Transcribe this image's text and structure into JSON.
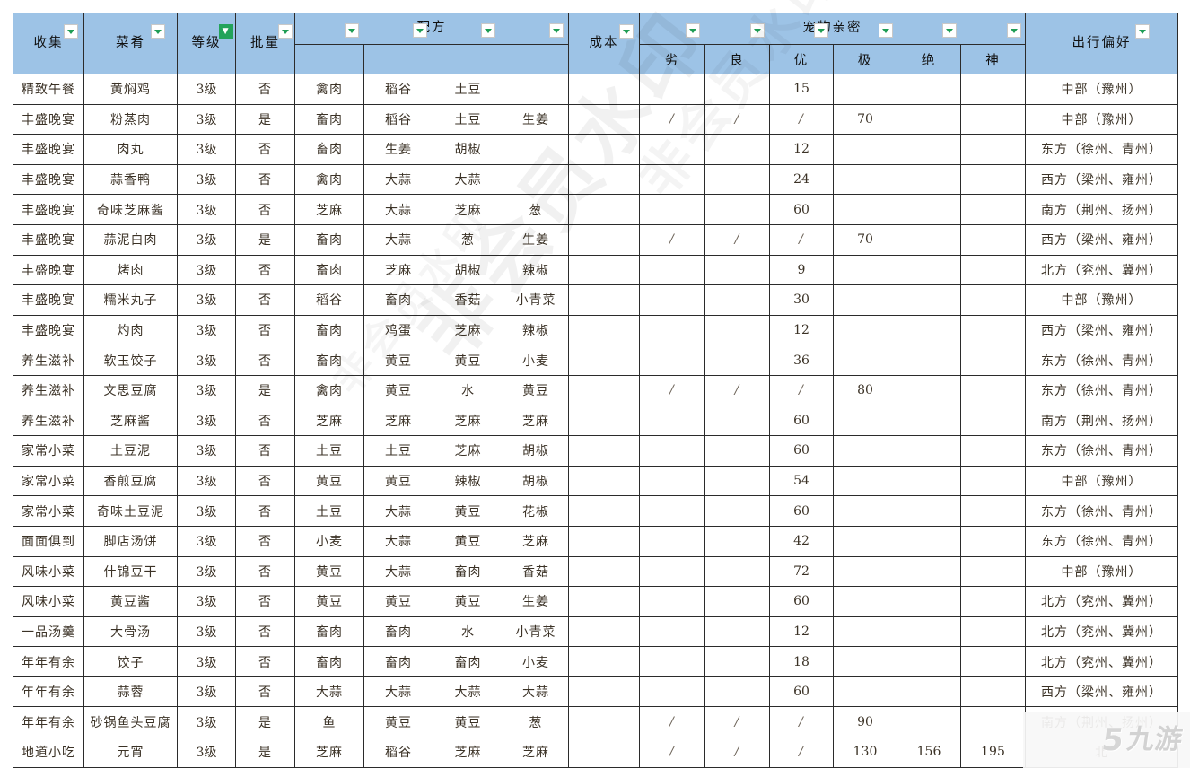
{
  "sheet": {
    "header": {
      "groups": [
        {
          "label": "收集",
          "key": "collect",
          "span": 1,
          "filter": "dropdown"
        },
        {
          "label": "菜肴",
          "key": "dish",
          "span": 1,
          "filter": "dropdown"
        },
        {
          "label": "等级",
          "key": "level",
          "span": 1,
          "filter": "active-filter"
        },
        {
          "label": "批量",
          "key": "batch",
          "span": 1,
          "filter": "dropdown"
        },
        {
          "label": "配方",
          "key": "recipe",
          "span": 4,
          "filter": "dropdown"
        },
        {
          "label": "成本",
          "key": "cost",
          "span": 1,
          "filter": "dropdown"
        },
        {
          "label": "宠物亲密",
          "key": "pet_intimacy",
          "span": 6,
          "filter": "dropdown"
        },
        {
          "label": "出行偏好",
          "key": "travel_pref",
          "span": 1,
          "filter": "dropdown"
        }
      ],
      "pet_sub_headers": [
        "劣",
        "良",
        "优",
        "极",
        "绝",
        "神"
      ]
    },
    "rows": [
      {
        "collect": "精致午餐",
        "dish": "黄焖鸡",
        "level": "3级",
        "batch": "否",
        "recipe": [
          "禽肉",
          "稻谷",
          "土豆",
          ""
        ],
        "cost": "",
        "pet": [
          "",
          "",
          "15",
          "",
          "",
          ""
        ],
        "travel": "中部（豫州）"
      },
      {
        "collect": "丰盛晚宴",
        "dish": "粉蒸肉",
        "level": "3级",
        "batch": "是",
        "recipe": [
          "畜肉",
          "稻谷",
          "土豆",
          "生姜"
        ],
        "cost": "",
        "pet": [
          "/",
          "/",
          "/",
          "70",
          "",
          ""
        ],
        "travel": "中部（豫州）"
      },
      {
        "collect": "丰盛晚宴",
        "dish": "肉丸",
        "level": "3级",
        "batch": "否",
        "recipe": [
          "畜肉",
          "生姜",
          "胡椒",
          ""
        ],
        "cost": "",
        "pet": [
          "",
          "",
          "12",
          "",
          "",
          ""
        ],
        "travel": "东方（徐州、青州）"
      },
      {
        "collect": "丰盛晚宴",
        "dish": "蒜香鸭",
        "level": "3级",
        "batch": "否",
        "recipe": [
          "禽肉",
          "大蒜",
          "大蒜",
          ""
        ],
        "cost": "",
        "pet": [
          "",
          "",
          "24",
          "",
          "",
          ""
        ],
        "travel": "西方（梁州、雍州）"
      },
      {
        "collect": "丰盛晚宴",
        "dish": "奇味芝麻酱",
        "level": "3级",
        "batch": "否",
        "recipe": [
          "芝麻",
          "大蒜",
          "芝麻",
          "葱"
        ],
        "cost": "",
        "pet": [
          "",
          "",
          "60",
          "",
          "",
          ""
        ],
        "travel": "南方（荆州、扬州）"
      },
      {
        "collect": "丰盛晚宴",
        "dish": "蒜泥白肉",
        "level": "3级",
        "batch": "是",
        "recipe": [
          "畜肉",
          "大蒜",
          "葱",
          "生姜"
        ],
        "cost": "",
        "pet": [
          "/",
          "/",
          "/",
          "70",
          "",
          ""
        ],
        "travel": "西方（梁州、雍州）"
      },
      {
        "collect": "丰盛晚宴",
        "dish": "烤肉",
        "level": "3级",
        "batch": "否",
        "recipe": [
          "畜肉",
          "芝麻",
          "胡椒",
          "辣椒"
        ],
        "cost": "",
        "pet": [
          "",
          "",
          "9",
          "",
          "",
          ""
        ],
        "travel": "北方（兖州、冀州）"
      },
      {
        "collect": "丰盛晚宴",
        "dish": "糯米丸子",
        "level": "3级",
        "batch": "否",
        "recipe": [
          "稻谷",
          "畜肉",
          "香菇",
          "小青菜"
        ],
        "cost": "",
        "pet": [
          "",
          "",
          "30",
          "",
          "",
          ""
        ],
        "travel": "中部（豫州）"
      },
      {
        "collect": "丰盛晚宴",
        "dish": "灼肉",
        "level": "3级",
        "batch": "否",
        "recipe": [
          "畜肉",
          "鸡蛋",
          "芝麻",
          "辣椒"
        ],
        "cost": "",
        "pet": [
          "",
          "",
          "12",
          "",
          "",
          ""
        ],
        "travel": "西方（梁州、雍州）"
      },
      {
        "collect": "养生滋补",
        "dish": "软玉饺子",
        "level": "3级",
        "batch": "否",
        "recipe": [
          "畜肉",
          "黄豆",
          "黄豆",
          "小麦"
        ],
        "cost": "",
        "pet": [
          "",
          "",
          "36",
          "",
          "",
          ""
        ],
        "travel": "东方（徐州、青州）"
      },
      {
        "collect": "养生滋补",
        "dish": "文思豆腐",
        "level": "3级",
        "batch": "是",
        "recipe": [
          "禽肉",
          "黄豆",
          "水",
          "黄豆"
        ],
        "cost": "",
        "pet": [
          "/",
          "/",
          "/",
          "80",
          "",
          ""
        ],
        "travel": "东方（徐州、青州）"
      },
      {
        "collect": "养生滋补",
        "dish": "芝麻酱",
        "level": "3级",
        "batch": "否",
        "recipe": [
          "芝麻",
          "芝麻",
          "芝麻",
          "芝麻"
        ],
        "cost": "",
        "pet": [
          "",
          "",
          "60",
          "",
          "",
          ""
        ],
        "travel": "南方（荆州、扬州）"
      },
      {
        "collect": "家常小菜",
        "dish": "土豆泥",
        "level": "3级",
        "batch": "否",
        "recipe": [
          "土豆",
          "土豆",
          "芝麻",
          "胡椒"
        ],
        "cost": "",
        "pet": [
          "",
          "",
          "60",
          "",
          "",
          ""
        ],
        "travel": "东方（徐州、青州）"
      },
      {
        "collect": "家常小菜",
        "dish": "香煎豆腐",
        "level": "3级",
        "batch": "否",
        "recipe": [
          "黄豆",
          "黄豆",
          "辣椒",
          "胡椒"
        ],
        "cost": "",
        "pet": [
          "",
          "",
          "54",
          "",
          "",
          ""
        ],
        "travel": "中部（豫州）"
      },
      {
        "collect": "家常小菜",
        "dish": "奇味土豆泥",
        "level": "3级",
        "batch": "否",
        "recipe": [
          "土豆",
          "大蒜",
          "黄豆",
          "花椒"
        ],
        "cost": "",
        "pet": [
          "",
          "",
          "60",
          "",
          "",
          ""
        ],
        "travel": "东方（徐州、青州）"
      },
      {
        "collect": "面面俱到",
        "dish": "脚店汤饼",
        "level": "3级",
        "batch": "否",
        "recipe": [
          "小麦",
          "大蒜",
          "黄豆",
          "芝麻"
        ],
        "cost": "",
        "pet": [
          "",
          "",
          "42",
          "",
          "",
          ""
        ],
        "travel": "东方（徐州、青州）"
      },
      {
        "collect": "风味小菜",
        "dish": "什锦豆干",
        "level": "3级",
        "batch": "否",
        "recipe": [
          "黄豆",
          "大蒜",
          "畜肉",
          "香菇"
        ],
        "cost": "",
        "pet": [
          "",
          "",
          "72",
          "",
          "",
          ""
        ],
        "travel": "中部（豫州）"
      },
      {
        "collect": "风味小菜",
        "dish": "黄豆酱",
        "level": "3级",
        "batch": "否",
        "recipe": [
          "黄豆",
          "黄豆",
          "黄豆",
          "生姜"
        ],
        "cost": "",
        "pet": [
          "",
          "",
          "60",
          "",
          "",
          ""
        ],
        "travel": "北方（兖州、冀州）"
      },
      {
        "collect": "一品汤羹",
        "dish": "大骨汤",
        "level": "3级",
        "batch": "否",
        "recipe": [
          "畜肉",
          "畜肉",
          "水",
          "小青菜"
        ],
        "cost": "",
        "pet": [
          "",
          "",
          "12",
          "",
          "",
          ""
        ],
        "travel": "北方（兖州、冀州）"
      },
      {
        "collect": "年年有余",
        "dish": "饺子",
        "level": "3级",
        "batch": "否",
        "recipe": [
          "畜肉",
          "畜肉",
          "畜肉",
          "小麦"
        ],
        "cost": "",
        "pet": [
          "",
          "",
          "18",
          "",
          "",
          ""
        ],
        "travel": "北方（兖州、冀州）"
      },
      {
        "collect": "年年有余",
        "dish": "蒜蓉",
        "level": "3级",
        "batch": "否",
        "recipe": [
          "大蒜",
          "大蒜",
          "大蒜",
          "大蒜"
        ],
        "cost": "",
        "pet": [
          "",
          "",
          "60",
          "",
          "",
          ""
        ],
        "travel": "西方（梁州、雍州）"
      },
      {
        "collect": "年年有余",
        "dish": "砂锅鱼头豆腐",
        "level": "3级",
        "batch": "是",
        "recipe": [
          "鱼",
          "黄豆",
          "黄豆",
          "葱"
        ],
        "cost": "",
        "pet": [
          "/",
          "/",
          "/",
          "90",
          "",
          ""
        ],
        "travel": "南方（荆州、扬州）"
      },
      {
        "collect": "地道小吃",
        "dish": "元宵",
        "level": "3级",
        "batch": "是",
        "recipe": [
          "芝麻",
          "稻谷",
          "芝麻",
          "芝麻"
        ],
        "cost": "",
        "pet": [
          "/",
          "/",
          "/",
          "130",
          "156",
          "195"
        ],
        "travel": "北"
      }
    ]
  },
  "watermark": {
    "text_main": "非会员水印",
    "text_secondary": "非会员水印",
    "text_tertiary": "非会员水印",
    "logo_mark": "5",
    "logo_text": "九游"
  },
  "colors": {
    "header_blue": "#9dc3e6",
    "filter_green": "#23a35a",
    "grid_line": "#2b2b2b",
    "cell_text": "#3b3226"
  }
}
